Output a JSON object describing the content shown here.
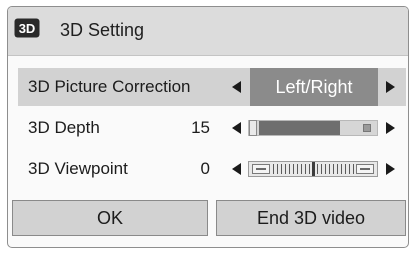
{
  "dialog": {
    "title": "3D Setting",
    "title_icon": "3d-badge-icon"
  },
  "rows": {
    "picture_correction": {
      "label": "3D Picture Correction",
      "value": "Left/Right"
    },
    "depth": {
      "label": "3D Depth",
      "value": "15",
      "level_fraction": 0.75
    },
    "viewpoint": {
      "label": "3D Viewpoint",
      "value": "0"
    }
  },
  "buttons": {
    "ok": "OK",
    "end_3d": "End 3D video"
  },
  "colors": {
    "selected_row": "#d2d2d2",
    "selected_value_box": "#8b8b8b",
    "button_bg": "#d2d2d2"
  }
}
